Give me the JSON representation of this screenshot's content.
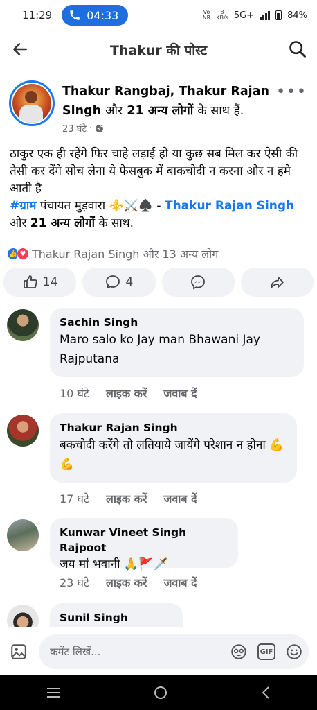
{
  "status_bar": {
    "time": "11:29",
    "call_timer": "04:33",
    "net_label_top": "Vo",
    "net_label_bottom": "NR",
    "speed_top": "8",
    "speed_bottom": "KB/s",
    "network": "5G+",
    "battery": "84%"
  },
  "header": {
    "title": "Thakur की पोस्ट"
  },
  "post": {
    "author_1": "Thakur Rangbaj, Thakur Rajan Singh",
    "with_word": "और",
    "others": "21 अन्य लोगों",
    "with_suffix": "के साथ हैं.",
    "time": "23 घंटे",
    "dot": "·",
    "body": "ठाकुर एक ही रहेंगे फिर चाहे लड़ाई हो या कुछ सब मिल कर ऐसी की तैसी कर देंगे सोच लेना ये फेसबुक में बाकचोदी न करना और न हमे आती है",
    "hashtag": "#ग्राम",
    "place": "पंचायत मुड़वारा",
    "emoji_tail": "⚜️⚔️♠️",
    "dash": "-",
    "tag_name": "Thakur Rajan Singh",
    "tag_and": "और",
    "tag_others": "21 अन्य लोगों",
    "tag_suffix": "के साथ."
  },
  "reactions": {
    "text": "Thakur Rajan Singh और 13 अन्य लोग"
  },
  "actions": {
    "likes": "14",
    "comments": "4"
  },
  "comments": [
    {
      "name": "Sachin Singh",
      "text": "Maro salo ko Jay man Bhawani Jay Rajputana",
      "time": "10 घंटे",
      "like": "लाइक करें",
      "reply": "जवाब दें"
    },
    {
      "name": "Thakur Rajan Singh",
      "text": "बकचोदी करेंगे तो लतियाये जायेंगे परेशान न होना 💪💪",
      "time": "17 घंटे",
      "like": "लाइक करें",
      "reply": "जवाब दें"
    },
    {
      "name": "Kunwar Vineet Singh Rajpoot",
      "text": "जय मां भवानी 🙏🚩🗡️",
      "time": "23 घंटे",
      "like": "लाइक करें",
      "reply": "जवाब दें"
    },
    {
      "name": "Sunil Singh",
      "text": "",
      "time": "",
      "like": "",
      "reply": ""
    }
  ],
  "comment_bar": {
    "placeholder": "कमेंट लिखें...",
    "gif_label": "GIF"
  },
  "colors": {
    "brand": "#1877f2",
    "bubble": "#f0f2f5",
    "secondary_text": "#65676b"
  }
}
